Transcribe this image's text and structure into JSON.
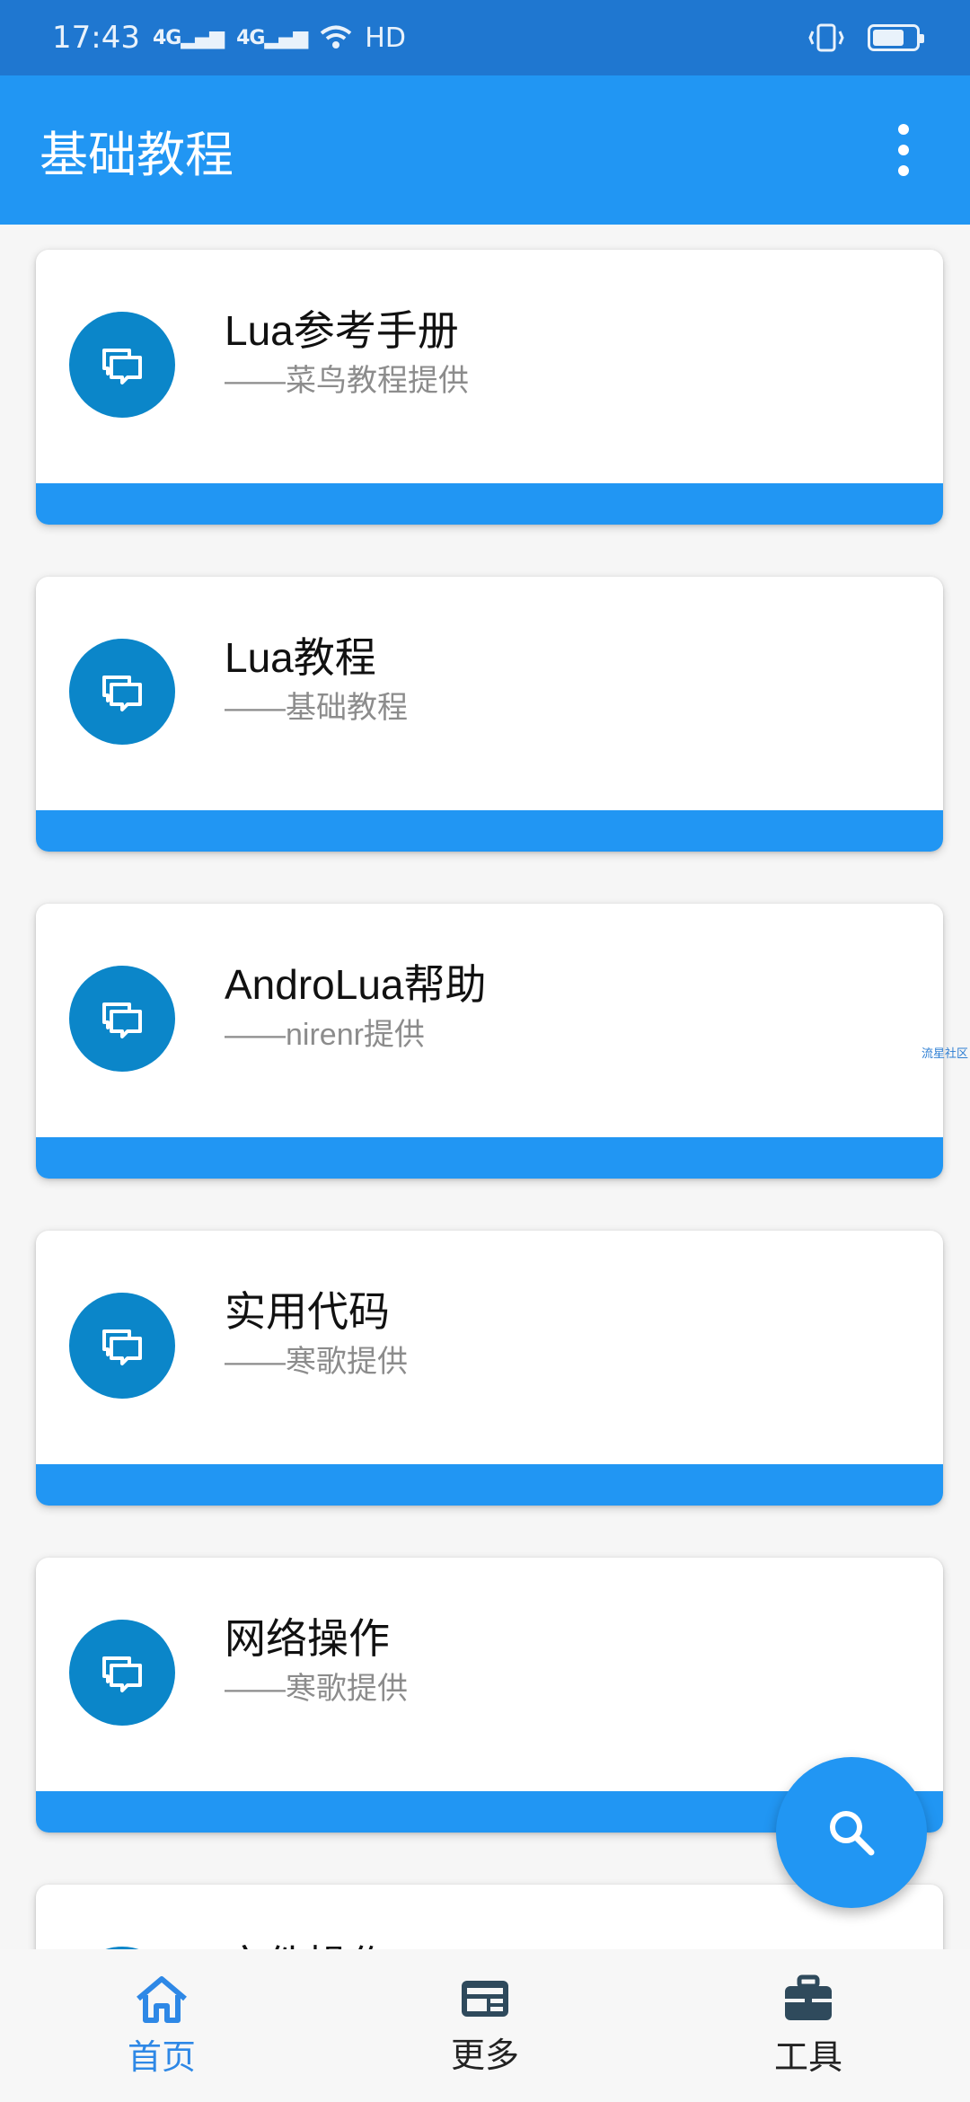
{
  "status_bar": {
    "time": "17:43",
    "network_1": "4G",
    "network_2": "4G",
    "hd": "HD"
  },
  "app_bar": {
    "title": "基础教程"
  },
  "cards": [
    {
      "title": "Lua参考手册",
      "subtitle": "——菜鸟教程提供"
    },
    {
      "title": "Lua教程",
      "subtitle": "——基础教程"
    },
    {
      "title": "AndroLua帮助",
      "subtitle": "——nirenr提供"
    },
    {
      "title": "实用代码",
      "subtitle": "——寒歌提供"
    },
    {
      "title": "网络操作",
      "subtitle": "——寒歌提供"
    },
    {
      "title": "文件操作",
      "subtitle": ""
    }
  ],
  "side_note": "流星社区",
  "bottom_nav": {
    "items": [
      {
        "label": "首页",
        "icon": "home-icon",
        "active": true
      },
      {
        "label": "更多",
        "icon": "news-icon",
        "active": false
      },
      {
        "label": "工具",
        "icon": "toolbox-icon",
        "active": false
      }
    ]
  },
  "colors": {
    "primary": "#2196f3",
    "status_bar": "#1f77d0",
    "icon_circle": "#0b86c9",
    "active_nav": "#2e88e6"
  }
}
